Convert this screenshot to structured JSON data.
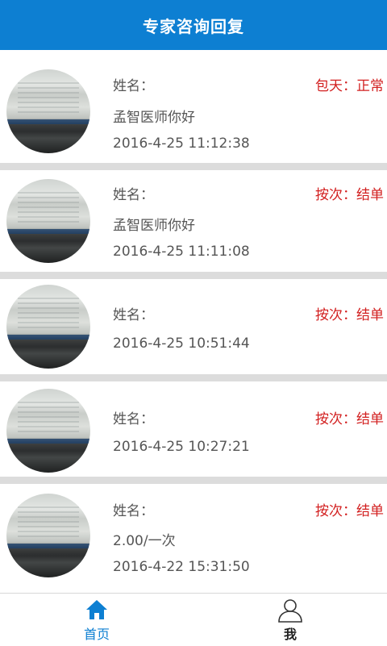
{
  "header": {
    "title": "专家咨询回复"
  },
  "items": [
    {
      "name_label": "姓名：",
      "status": "包天：正常",
      "message": "孟智医师你好",
      "date": "2016-4-25 11:12:38"
    },
    {
      "name_label": "姓名：",
      "status": "按次：结单",
      "message": "孟智医师你好",
      "date": "2016-4-25 11:11:08"
    },
    {
      "name_label": "姓名：",
      "status": "按次：结单",
      "message": "",
      "date": "2016-4-25 10:51:44"
    },
    {
      "name_label": "姓名：",
      "status": "按次：结单",
      "message": "",
      "date": "2016-4-25 10:27:21"
    },
    {
      "name_label": "姓名：",
      "status": "按次：结单",
      "message": "2.00/一次",
      "date": "2016-4-22 15:31:50"
    }
  ],
  "tabs": {
    "home": "首页",
    "me": "我"
  },
  "colors": {
    "header": "#0d7fd2",
    "status": "#d21f1f",
    "active_tab": "#0d7fd2"
  },
  "icons": {
    "home": "home-icon",
    "me": "user-icon"
  }
}
